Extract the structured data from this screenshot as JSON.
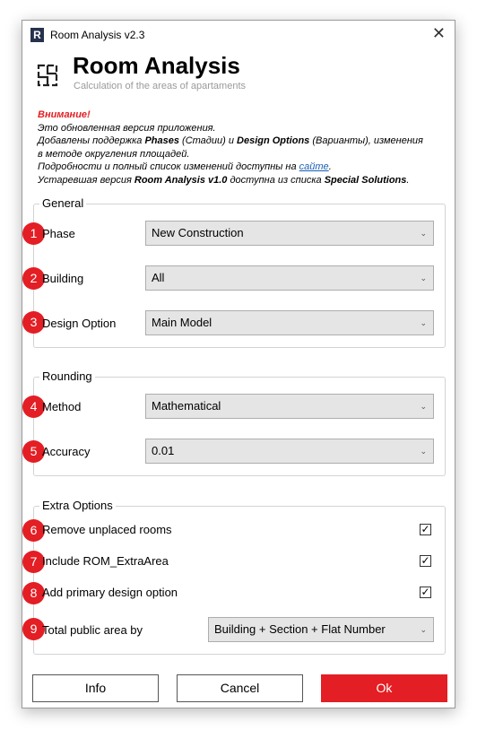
{
  "window": {
    "title": "Room Analysis v2.3",
    "app_icon_letter": "R"
  },
  "header": {
    "title": "Room Analysis",
    "subtitle": "Calculation of the areas of apartaments"
  },
  "notice": {
    "warning": "Внимание!",
    "line1": "Это обновленная версия приложения.",
    "line2_a": "Добавлены поддержка ",
    "line2_b": "Phases",
    "line2_c": " (Стадии) и ",
    "line2_d": "Design Options",
    "line2_e": " (Варианты), изменения",
    "line3": "в методе округления площадей.",
    "line4_a": "Подробности и полный список изменений доступны на ",
    "line4_link": "сайте",
    "line4_b": ".",
    "line5_a": "Устаревшая версия ",
    "line5_b": "Room Analysis v1.0",
    "line5_c": " доступна из списка ",
    "line5_d": "Special Solutions",
    "line5_e": "."
  },
  "general": {
    "legend": "General",
    "phase": {
      "num": "1",
      "label": "Phase",
      "value": "New Construction"
    },
    "building": {
      "num": "2",
      "label": "Building",
      "value": "All"
    },
    "design_option": {
      "num": "3",
      "label": "Design Option",
      "value": "Main Model"
    }
  },
  "rounding": {
    "legend": "Rounding",
    "method": {
      "num": "4",
      "label": "Method",
      "value": "Mathematical"
    },
    "accuracy": {
      "num": "5",
      "label": "Accuracy",
      "value": "0.01"
    }
  },
  "extra": {
    "legend": "Extra Options",
    "remove_unplaced": {
      "num": "6",
      "label": "Remove unplaced rooms",
      "checked": true
    },
    "include_extra": {
      "num": "7",
      "label": "Include ROM_ExtraArea",
      "checked": true
    },
    "add_primary": {
      "num": "8",
      "label": "Add primary design option",
      "checked": true
    },
    "total_public": {
      "num": "9",
      "label": "Total public area by",
      "value": "Building + Section + Flat Number"
    }
  },
  "buttons": {
    "info": "Info",
    "cancel": "Cancel",
    "ok": "Ok"
  },
  "symbols": {
    "close": "✕",
    "caret": "⌄",
    "check": "✓"
  },
  "colors": {
    "accent": "#e31e24",
    "link": "#1a5fb4"
  }
}
